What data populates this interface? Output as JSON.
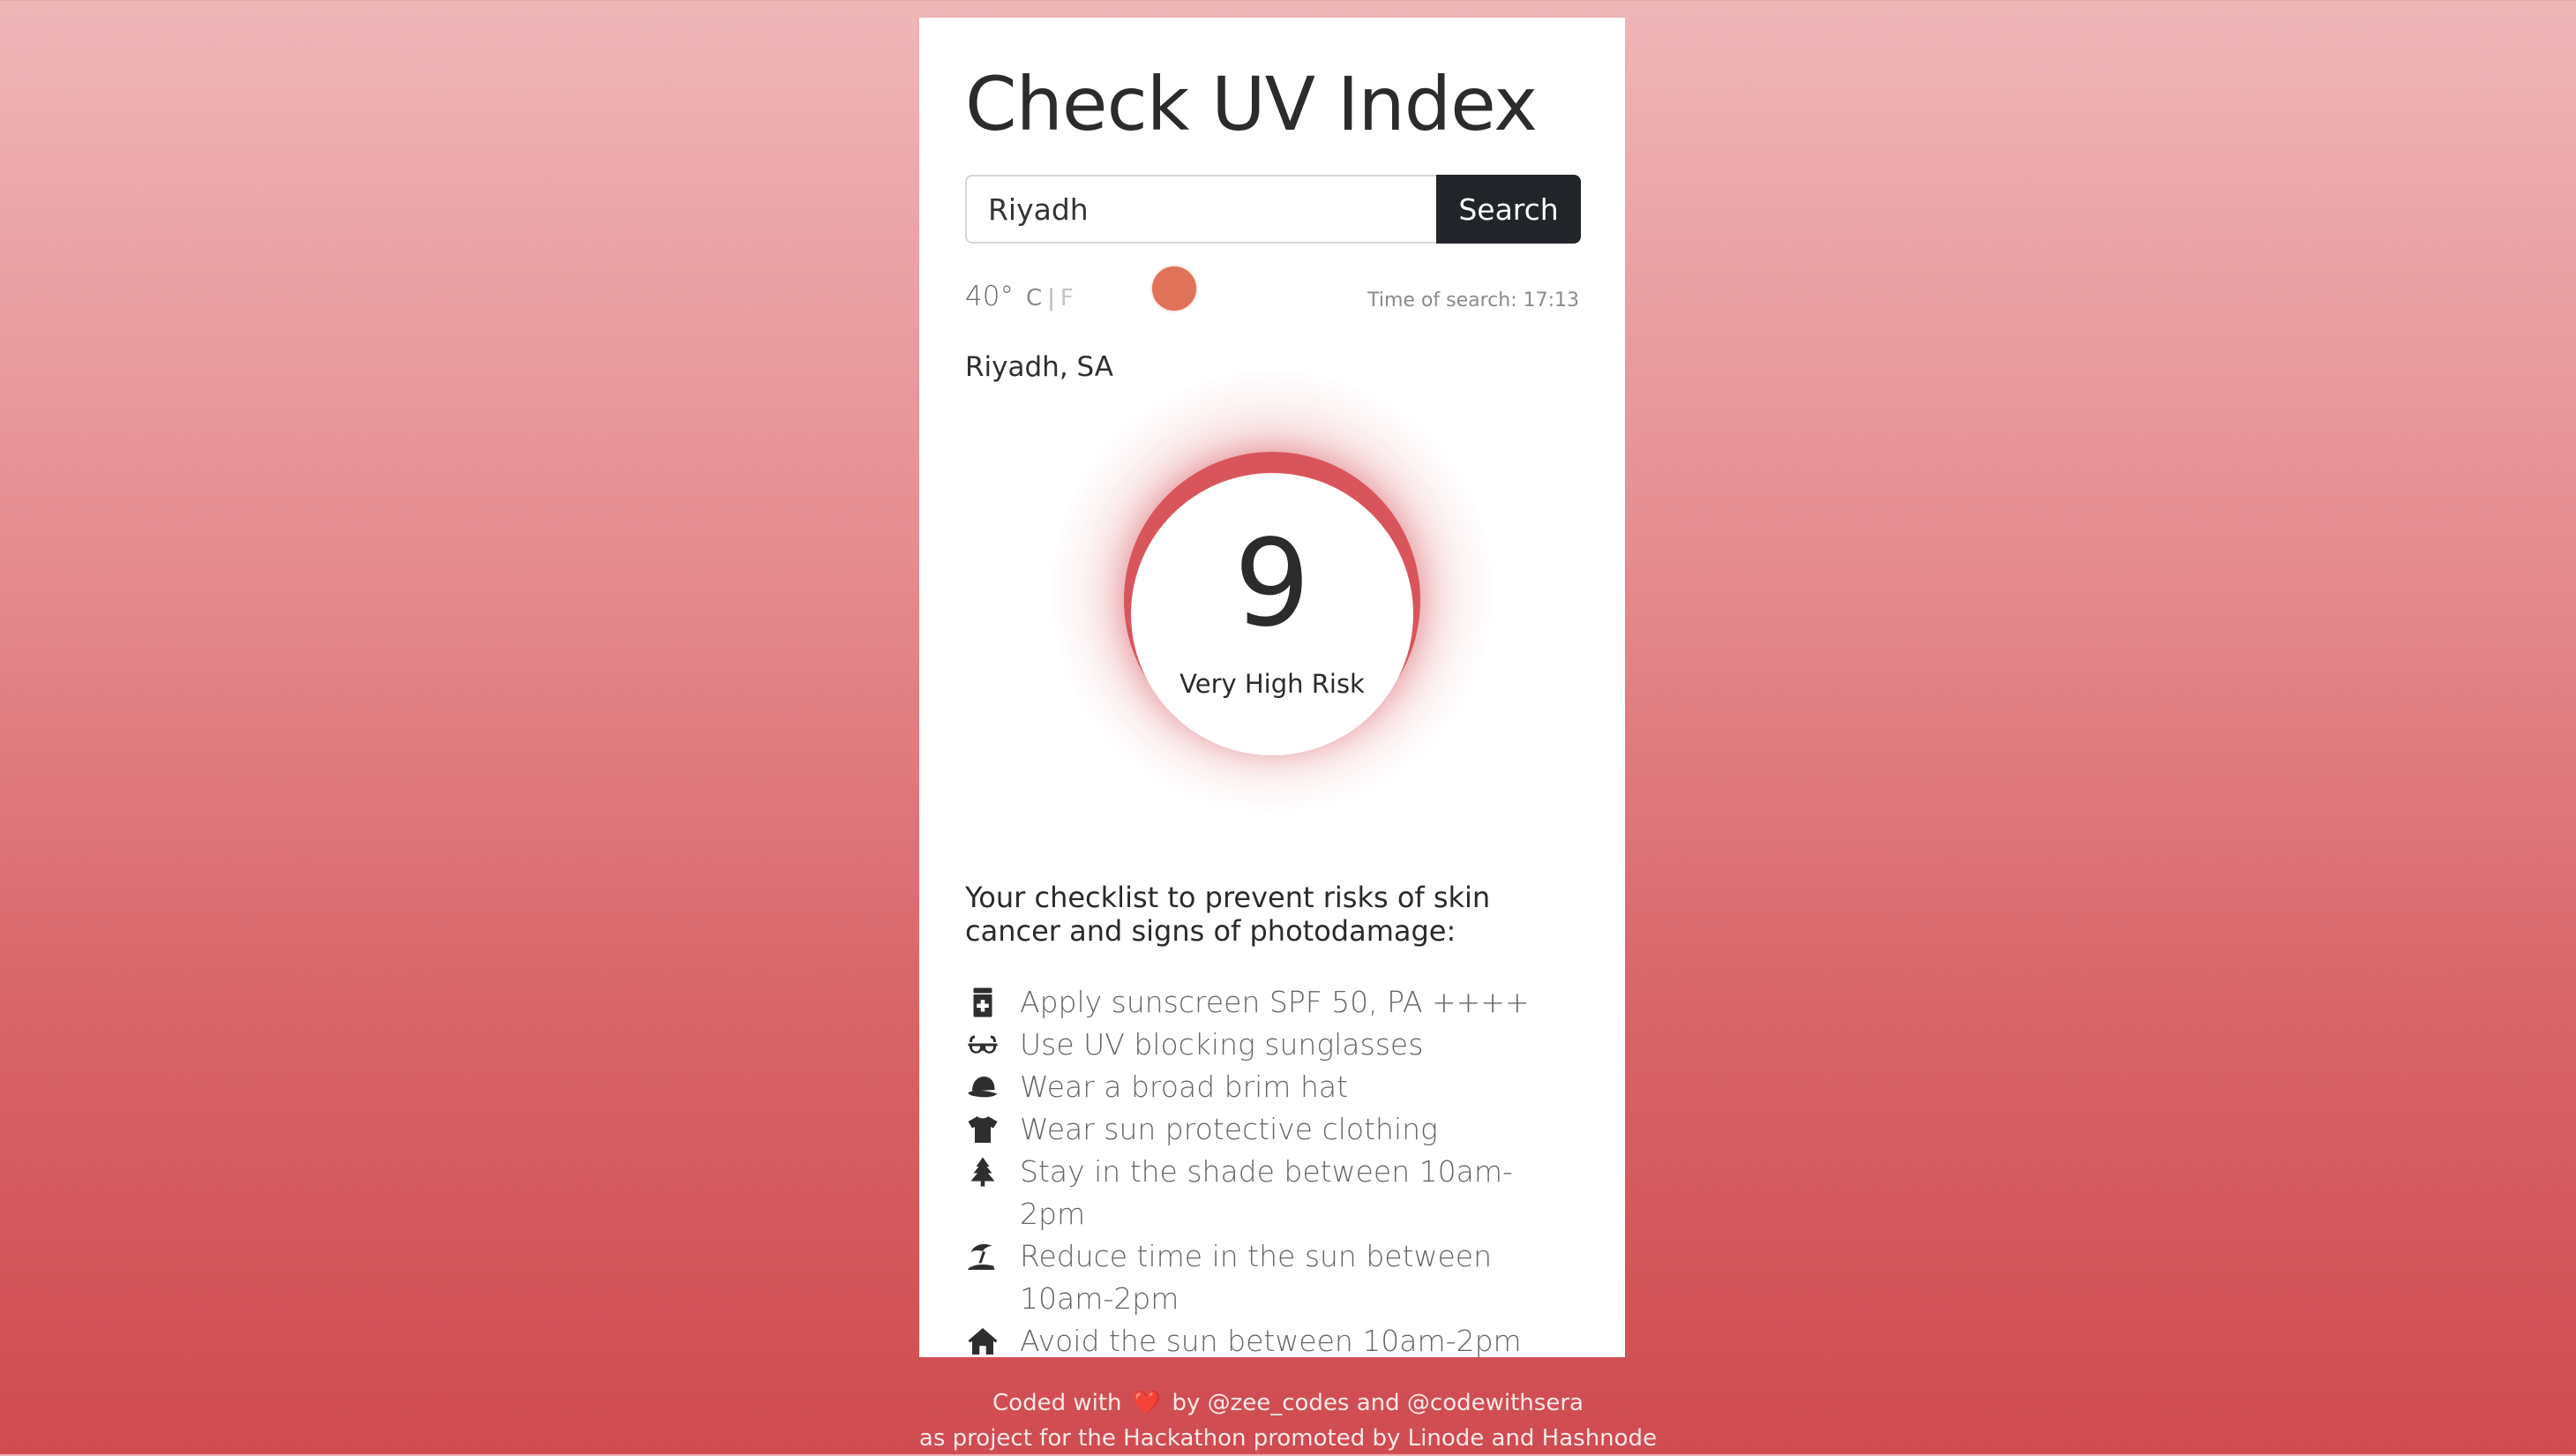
{
  "header": {
    "title": "Check UV Index"
  },
  "search": {
    "value": "Riyadh",
    "button_label": "Search"
  },
  "weather": {
    "temperature": "40°",
    "unit_c": "C",
    "unit_separator": "|",
    "unit_f": "F",
    "time_label": "Time of search: 17:13",
    "location": "Riyadh, SA",
    "sun_color": "#e07259"
  },
  "uv": {
    "value": "9",
    "risk": "Very High Risk",
    "ring_color": "#d9555c"
  },
  "checklist": {
    "heading": "Your checklist to prevent risks of skin cancer and signs of photodamage:",
    "items": [
      {
        "icon": "sunscreen-bottle-icon",
        "text": "Apply sunscreen SPF 50, PA ++++"
      },
      {
        "icon": "glasses-icon",
        "text": "Use UV blocking sunglasses"
      },
      {
        "icon": "hat-icon",
        "text": "Wear a broad brim hat"
      },
      {
        "icon": "tshirt-icon",
        "text": "Wear sun protective clothing"
      },
      {
        "icon": "tree-icon",
        "text": "Stay in the shade between 10am-2pm"
      },
      {
        "icon": "umbrella-beach-icon",
        "text": "Reduce time in the sun between 10am-2pm"
      },
      {
        "icon": "home-icon",
        "text": "Avoid the sun between 10am-2pm"
      }
    ]
  },
  "footer": {
    "line1_prefix": "Coded with",
    "heart": "❤️",
    "line1_suffix": "by @zee_codes and @codewithsera",
    "line2": "as project for the Hackathon promoted by Linode and Hashnode"
  },
  "colors": {
    "accent_dark": "#212529",
    "background_top": "#efb6b8",
    "background_bottom": "#cf4b50"
  }
}
